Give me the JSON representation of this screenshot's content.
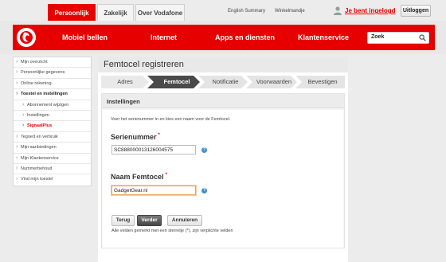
{
  "topbar": {
    "tabs": [
      {
        "label": "Persoonlijk",
        "active": true
      },
      {
        "label": "Zakelijk",
        "active": false
      },
      {
        "label": "Over Vodafone",
        "active": false
      }
    ],
    "links": [
      "English Summary",
      "Winkelmandje"
    ],
    "user_status": "Je bent ingelogd",
    "logout_label": "Uitloggen",
    "user_icon": "user-icon"
  },
  "nav": {
    "brand_color": "#e60000",
    "logo_icon": "vodafone-speechmark-icon",
    "items": [
      "Mobiel bellen",
      "Internet",
      "Apps en diensten",
      "Klantenservice"
    ],
    "search_placeholder": "Zoek",
    "search_icon": "search-icon"
  },
  "sidebar": {
    "items": [
      {
        "label": "Mijn overzicht"
      },
      {
        "label": "Persoonlijke gegevens"
      },
      {
        "label": "Online rekening"
      },
      {
        "label": "Toestel en instellingen"
      },
      {
        "label": "Abonnement wijzigen"
      },
      {
        "label": "Instellingen"
      },
      {
        "label": "SignaalPlus"
      },
      {
        "label": "Tegoed en verbruik"
      },
      {
        "label": "Mijn aanbiedingen"
      },
      {
        "label": "Mijn Klantenservice"
      },
      {
        "label": "Nummerbehoud"
      },
      {
        "label": "Vind mijn toestel"
      }
    ]
  },
  "main": {
    "title": "Femtocel registreren",
    "steps": [
      {
        "label": "Adres",
        "state": "done"
      },
      {
        "label": "Femtocel",
        "state": "active"
      },
      {
        "label": "Notificatie",
        "state": "todo"
      },
      {
        "label": "Voorwaarden",
        "state": "todo"
      },
      {
        "label": "Bevestigen",
        "state": "todo"
      }
    ],
    "panel_title": "Instellingen",
    "intro": "Voer het serienummer in en kies een naam voor de Femtocel.",
    "serial": {
      "label": "Serienummer",
      "required_mark": "*",
      "value": "SC888000013126004575"
    },
    "name": {
      "label": "Naam Femtocel",
      "required_mark": "*",
      "value": "GadgetGear.nl"
    },
    "help_glyph": "?",
    "buttons": {
      "back": "Terug",
      "next": "Verder",
      "cancel": "Annuleren"
    },
    "required_note": "Alle velden gemerkt met een sterretje (*), zijn verplichte velden"
  }
}
